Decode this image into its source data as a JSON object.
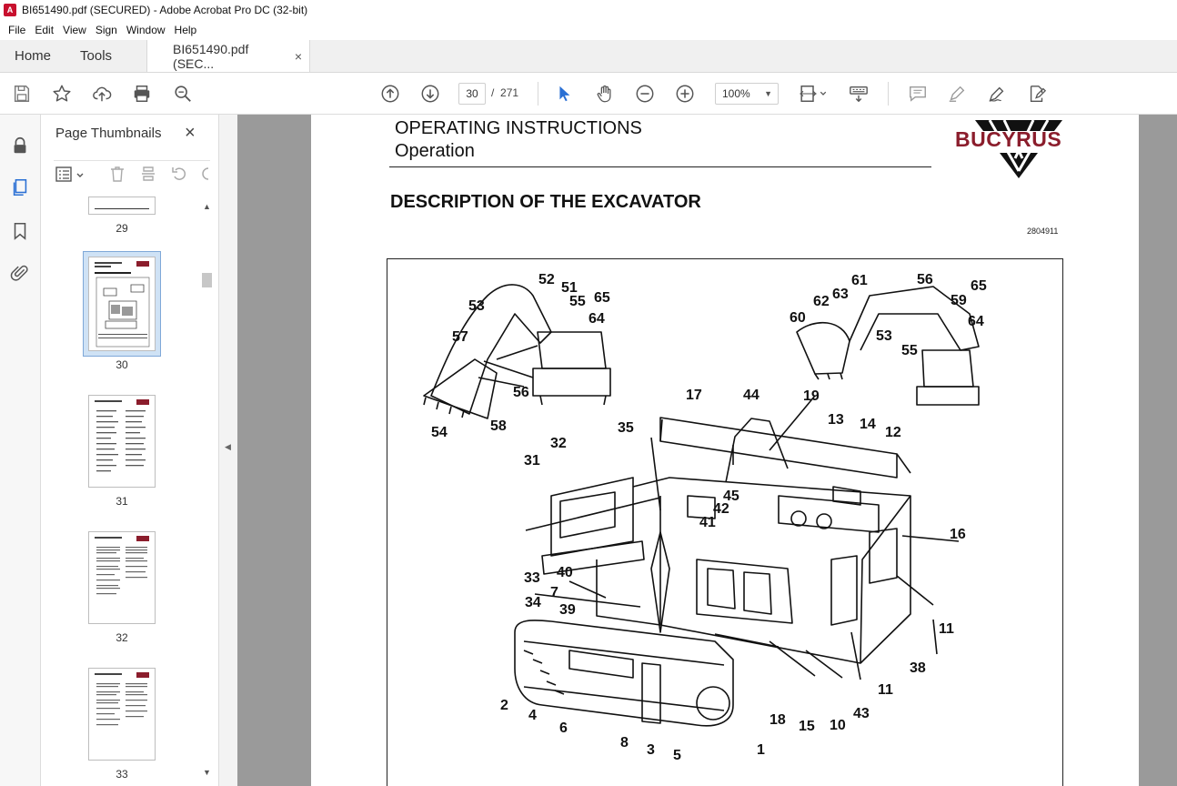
{
  "window": {
    "title": "BI651490.pdf (SECURED) - Adobe Acrobat Pro DC (32-bit)"
  },
  "menu": [
    "File",
    "Edit",
    "View",
    "Sign",
    "Window",
    "Help"
  ],
  "tabs": {
    "home": "Home",
    "tools": "Tools",
    "document": "BI651490.pdf (SEC...",
    "close": "×"
  },
  "toolbar": {
    "current_page": "30",
    "page_separator": "/",
    "total_pages": "271",
    "zoom": "100%"
  },
  "panel": {
    "title": "Page Thumbnails",
    "close": "×",
    "thumbnails": [
      {
        "label": "29"
      },
      {
        "label": "30",
        "selected": true
      },
      {
        "label": "31"
      },
      {
        "label": "32"
      },
      {
        "label": "33"
      }
    ]
  },
  "document": {
    "header_title": "OPERATING INSTRUCTIONS",
    "header_subtitle": "Operation",
    "brand": "BUCYRUS",
    "section_title": "DESCRIPTION OF THE EXCAVATOR",
    "doc_number": "2804911",
    "callouts": [
      {
        "text": "52"
      },
      {
        "text": "51"
      },
      {
        "text": "55"
      },
      {
        "text": "65"
      },
      {
        "text": "53"
      },
      {
        "text": "64"
      },
      {
        "text": "57"
      },
      {
        "text": "56"
      },
      {
        "text": "58"
      },
      {
        "text": "54"
      },
      {
        "text": "61"
      },
      {
        "text": "56"
      },
      {
        "text": "62"
      },
      {
        "text": "63"
      },
      {
        "text": "65"
      },
      {
        "text": "59"
      },
      {
        "text": "60"
      },
      {
        "text": "64"
      },
      {
        "text": "53"
      },
      {
        "text": "55"
      },
      {
        "text": "17"
      },
      {
        "text": "44"
      },
      {
        "text": "19"
      },
      {
        "text": "35"
      },
      {
        "text": "13"
      },
      {
        "text": "14"
      },
      {
        "text": "12"
      },
      {
        "text": "32"
      },
      {
        "text": "31"
      },
      {
        "text": "45"
      },
      {
        "text": "42"
      },
      {
        "text": "41"
      },
      {
        "text": "16"
      },
      {
        "text": "33"
      },
      {
        "text": "40"
      },
      {
        "text": "7"
      },
      {
        "text": "34"
      },
      {
        "text": "39"
      },
      {
        "text": "11"
      },
      {
        "text": "38"
      },
      {
        "text": "11"
      },
      {
        "text": "2"
      },
      {
        "text": "4"
      },
      {
        "text": "6"
      },
      {
        "text": "18"
      },
      {
        "text": "15"
      },
      {
        "text": "10"
      },
      {
        "text": "43"
      },
      {
        "text": "8"
      },
      {
        "text": "3"
      },
      {
        "text": "5"
      },
      {
        "text": "1"
      }
    ]
  },
  "colors": {
    "brand": "#8b1d2c",
    "accent": "#2b70d4",
    "docbg": "#9a9a9a"
  }
}
